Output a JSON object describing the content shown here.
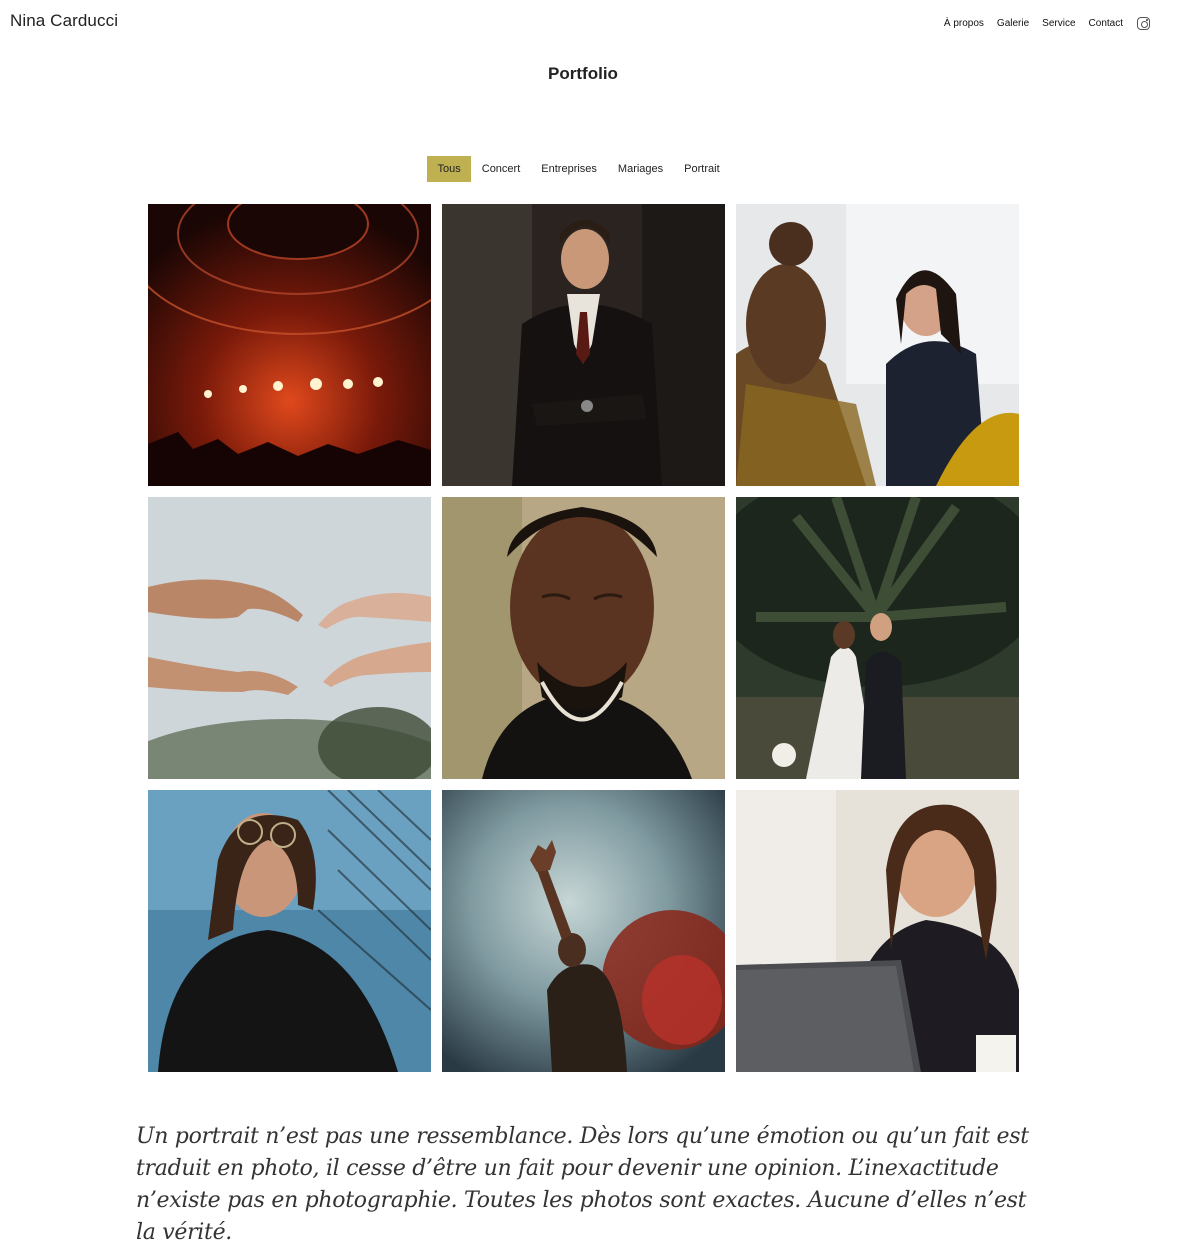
{
  "header": {
    "brand": "Nina Carducci",
    "nav": [
      "À propos",
      "Galerie",
      "Service",
      "Contact"
    ],
    "social_icon": "instagram-icon"
  },
  "page": {
    "title": "Portfolio"
  },
  "filters": {
    "items": [
      "Tous",
      "Concert",
      "Entreprises",
      "Mariages",
      "Portrait"
    ],
    "active": "Tous",
    "active_color": "#bfb052"
  },
  "gallery": {
    "items": [
      {
        "subject": "concert-stage-lights"
      },
      {
        "subject": "businessman-portrait"
      },
      {
        "subject": "office-meeting"
      },
      {
        "subject": "reaching-hands"
      },
      {
        "subject": "man-closed-eyes-portrait"
      },
      {
        "subject": "wedding-couple-palm"
      },
      {
        "subject": "woman-glasses-portrait"
      },
      {
        "subject": "concert-raised-hand"
      },
      {
        "subject": "woman-laptop-laughing"
      }
    ]
  },
  "quote": {
    "text": "Un portrait n’est pas une ressemblance. Dès lors qu’une émotion ou qu’un fait est traduit en photo, il cesse d’être un fait pour devenir une opinion. L’inexactitude n’existe pas en photographie. Toutes les photos sont exactes. Aucune d’elles n’est la vérité."
  }
}
